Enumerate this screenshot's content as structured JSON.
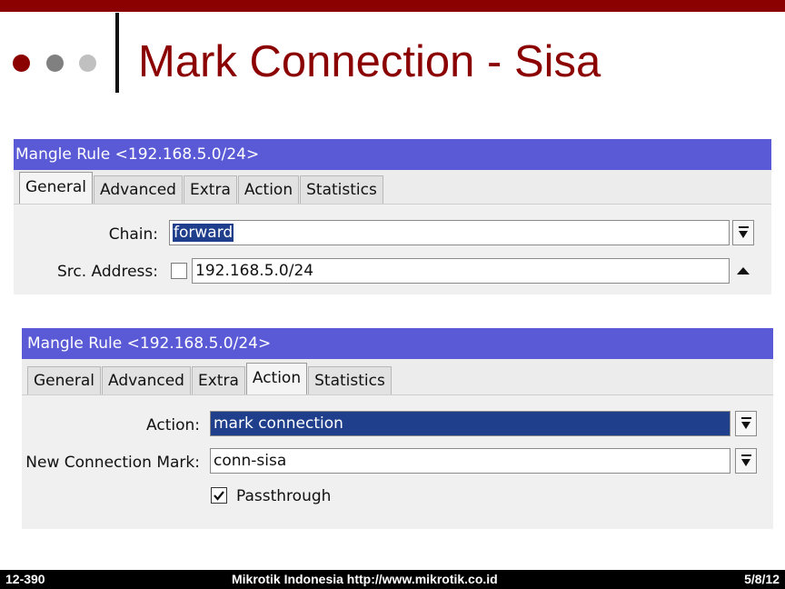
{
  "slide": {
    "title": "Mark Connection - Sisa",
    "bullet_colors": [
      "#8b0000",
      "#808080",
      "#c0c0c0"
    ],
    "accent_color": "#8b0000"
  },
  "window1": {
    "title": "Mangle Rule <192.168.5.0/24>",
    "tabs": [
      "General",
      "Advanced",
      "Extra",
      "Action",
      "Statistics"
    ],
    "active_tab": "General",
    "chain_label": "Chain:",
    "chain_value": "forward",
    "src_label": "Src. Address:",
    "src_value": "192.168.5.0/24"
  },
  "window2": {
    "title": "Mangle Rule <192.168.5.0/24>",
    "tabs": [
      "General",
      "Advanced",
      "Extra",
      "Action",
      "Statistics"
    ],
    "active_tab": "Action",
    "action_label": "Action:",
    "action_value": "mark connection",
    "mark_label": "New Connection Mark:",
    "mark_value": "conn-sisa",
    "passthrough_label": "Passthrough",
    "passthrough_checked": true
  },
  "footer": {
    "left": "12-390",
    "center": "Mikrotik Indonesia http://www.mikrotik.co.id",
    "right": "5/8/12"
  }
}
